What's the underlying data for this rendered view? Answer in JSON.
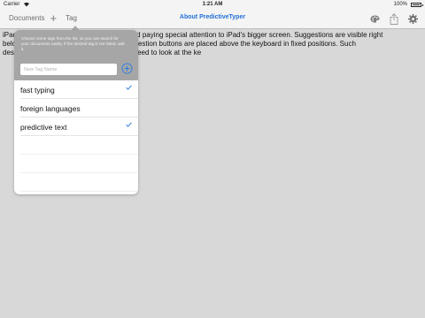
{
  "status_bar": {
    "carrier": "Carrier",
    "time": "1:21 AM",
    "battery": "100%"
  },
  "nav": {
    "documents": "Documents",
    "add_symbol": "+",
    "tag": "Tag",
    "title": "About PredictiveTyper",
    "icons": [
      "palette-icon",
      "share-icon",
      "gear-icon"
    ]
  },
  "document": {
    "lines": [
      "iPad version of PredictiveTyper was created paying special attention to iPad's bigger screen. Suggestions are visible right",
      "below the text input field, while six big suggestion buttons are placed above the keyboard in fixed positions. Such",
      "design allows you to type fast without the need to look at the ke"
    ]
  },
  "tag_popover": {
    "instructions": "Choose some tags from the list, so you can search for your documents easily. If the desired tag is not listed, add it.",
    "input_placeholder": "New Tag Name",
    "tags": [
      {
        "label": "fast typing",
        "checked": true
      },
      {
        "label": "foreign languages",
        "checked": false
      },
      {
        "label": "predictive text",
        "checked": true
      }
    ],
    "accent_color": "#2a7de1"
  }
}
